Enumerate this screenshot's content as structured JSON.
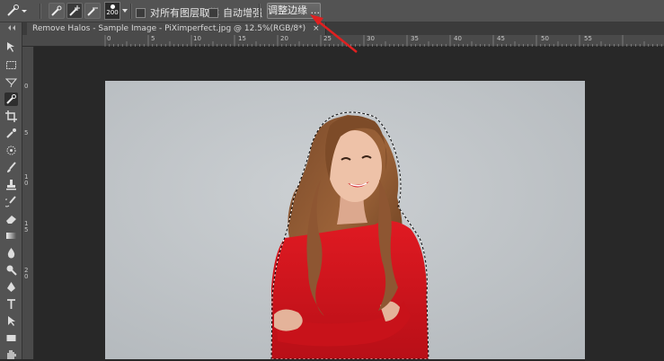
{
  "options_bar": {
    "brush_size": "200",
    "sample_all_layers_label": "对所有图层取样",
    "auto_enhance_label": "自动增强",
    "refine_edge_label": "调整边缘 ..."
  },
  "document_tab": {
    "title": "Remove Halos - Sample Image - PiXimperfect.jpg @ 12.5%(RGB/8*)",
    "close": "×"
  },
  "ruler_top_labels": [
    "0",
    "5",
    "10",
    "15",
    "20",
    "25",
    "30",
    "35",
    "40",
    "45",
    "50",
    "55"
  ],
  "ruler_left_labels": [
    "0",
    "5",
    "1 0",
    "1 5",
    "2 0"
  ],
  "colors": {
    "accent_arrow": "#e02020",
    "sweater": "#d6141c",
    "backdrop": "#c3c7ca"
  },
  "tools": [
    "move-icon",
    "marquee-icon",
    "lasso-icon",
    "quick-selection-icon",
    "crop-icon",
    "eyedropper-icon",
    "healing-icon",
    "brush-icon",
    "stamp-icon",
    "history-brush-icon",
    "eraser-icon",
    "gradient-icon",
    "blur-icon",
    "dodge-icon",
    "pen-icon",
    "type-icon",
    "path-selection-icon",
    "rectangle-icon",
    "hand-icon"
  ]
}
